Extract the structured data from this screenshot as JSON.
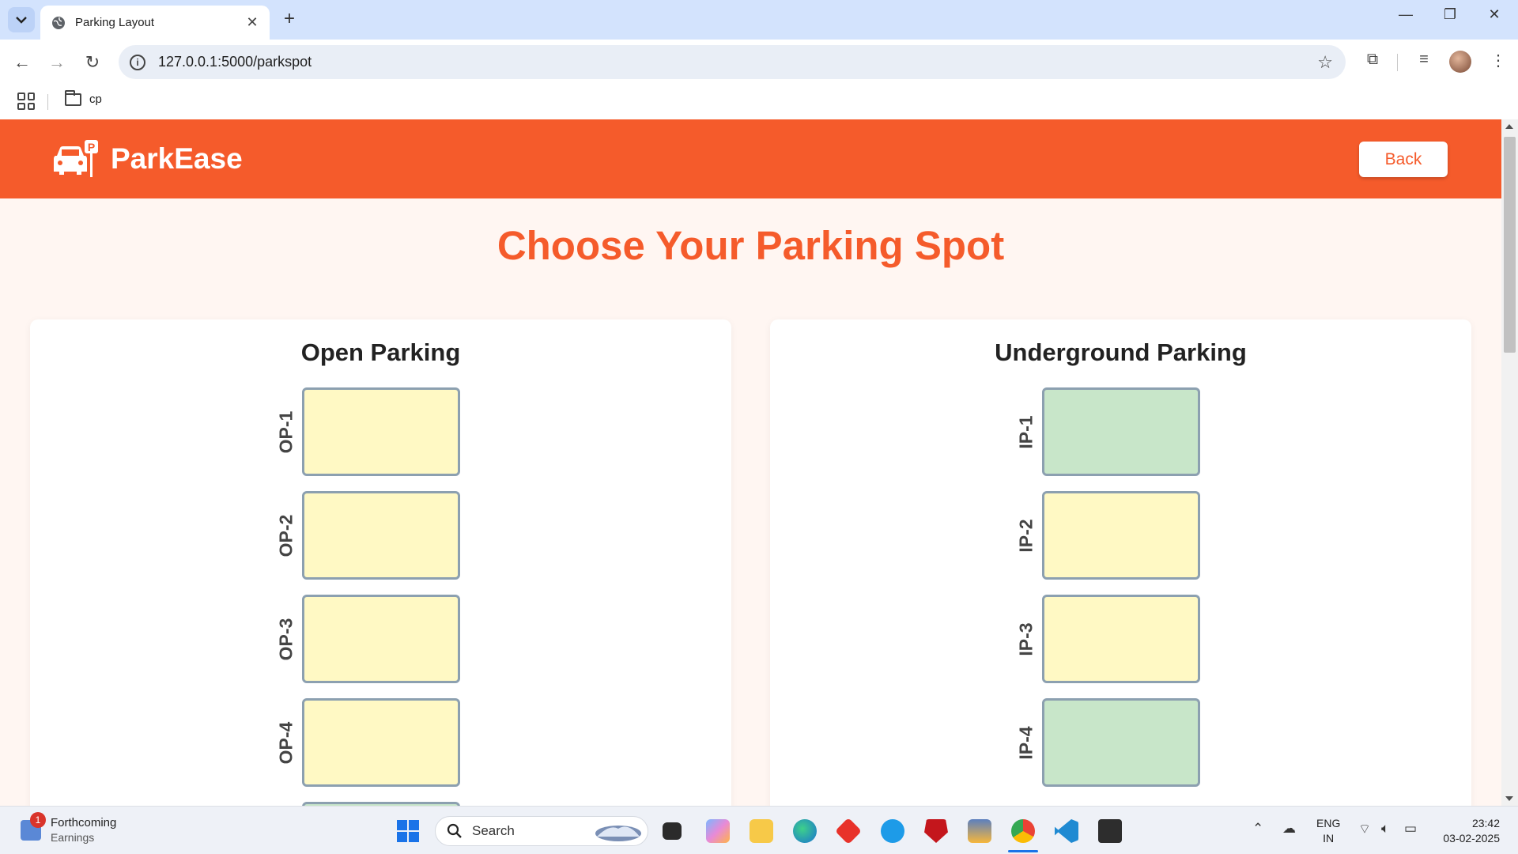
{
  "browser": {
    "tab_title": "Parking Layout",
    "url": "127.0.0.1:5000/parkspot",
    "bookmark_folder": "cp"
  },
  "app": {
    "brand": "ParkEase",
    "back_label": "Back",
    "page_title": "Choose Your Parking Spot",
    "colors": {
      "accent": "#f55b2b",
      "available": "#fff9c4",
      "occupied": "#c8e6c9",
      "spot_border": "#8ca0b0",
      "page_bg": "#fff6f2"
    }
  },
  "sections": [
    {
      "title": "Open Parking",
      "spots": [
        {
          "label": "OP-1",
          "status": "available"
        },
        {
          "label": "OP-2",
          "status": "available"
        },
        {
          "label": "OP-3",
          "status": "available"
        },
        {
          "label": "OP-4",
          "status": "available"
        },
        {
          "label": "",
          "status": "occupied"
        }
      ]
    },
    {
      "title": "Underground Parking",
      "spots": [
        {
          "label": "IP-1",
          "status": "occupied"
        },
        {
          "label": "IP-2",
          "status": "available"
        },
        {
          "label": "IP-3",
          "status": "available"
        },
        {
          "label": "IP-4",
          "status": "occupied"
        }
      ]
    }
  ],
  "taskbar": {
    "widget_badge": "1",
    "widget_title": "Forthcoming",
    "widget_subtitle": "Earnings",
    "search_label": "Search",
    "lang_line1": "ENG",
    "lang_line2": "IN",
    "time": "23:42",
    "date": "03-02-2025"
  }
}
